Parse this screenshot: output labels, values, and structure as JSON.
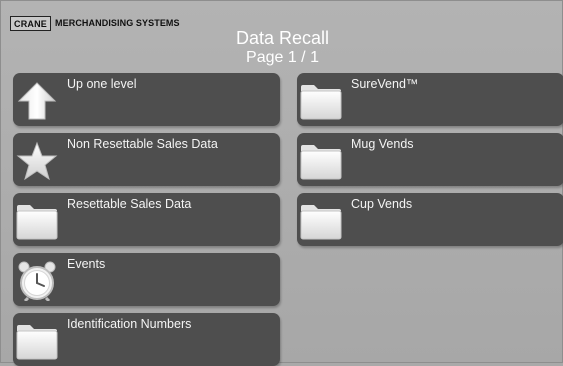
{
  "header": {
    "brand_logo": "CRANE",
    "brand_name": "MERCHANDISING SYSTEMS",
    "title": "Data Recall",
    "page_indicator": "Page 1 / 1"
  },
  "tiles": [
    {
      "label": "Up one level",
      "icon": "up-arrow-icon"
    },
    {
      "label": "Non Resettable Sales Data",
      "icon": "star-icon"
    },
    {
      "label": "Resettable Sales Data",
      "icon": "folder-icon"
    },
    {
      "label": "Events",
      "icon": "alarm-clock-icon"
    },
    {
      "label": "Identification Numbers",
      "icon": "folder-icon"
    },
    {
      "label": "SureVend™",
      "icon": "folder-icon"
    },
    {
      "label": "Mug Vends",
      "icon": "folder-icon"
    },
    {
      "label": "Cup Vends",
      "icon": "folder-icon"
    }
  ],
  "colors": {
    "background": "#a9a9a9",
    "tile": "#4e4e4e",
    "text": "#ffffff"
  }
}
